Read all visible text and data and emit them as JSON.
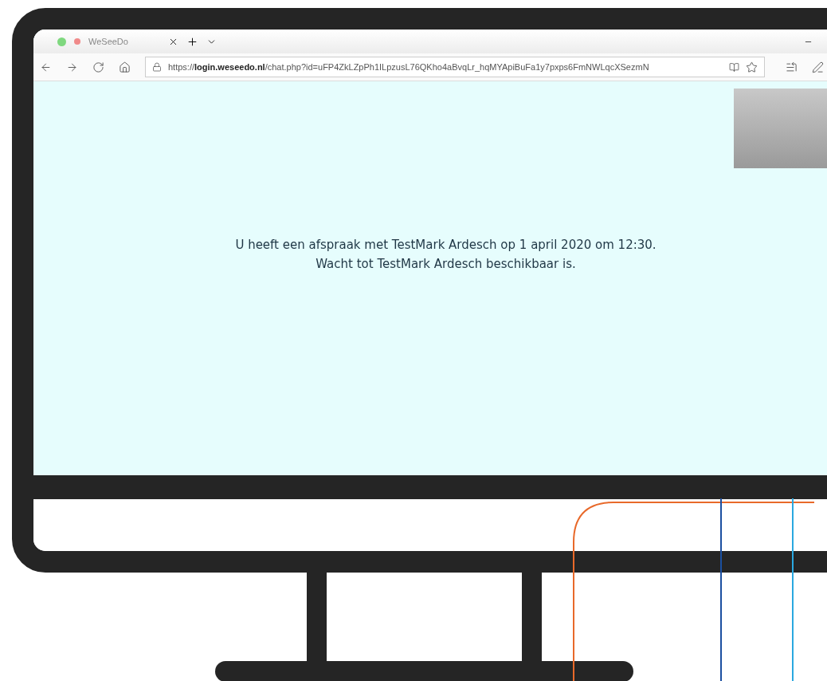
{
  "browser": {
    "tab": {
      "title": "WeSeeDo"
    },
    "address_bar": {
      "url": "https://**login.weseedo.nl**/chat.php?id=uFP4ZkLZpPh1ILpzusL76QKho4aBvqLr_hqMYApiBuFa1y7pxps6FmNWLqcXSezmN"
    }
  },
  "page": {
    "message_lines": [
      "U heeft een afspraak met TestMark Ardesch op 1 april 2020 om 12:30.",
      "Wacht tot TestMark Ardesch beschikbaar is."
    ]
  }
}
